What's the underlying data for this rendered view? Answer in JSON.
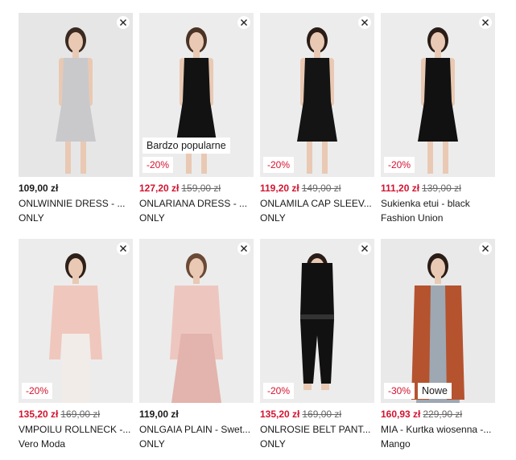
{
  "products": [
    {
      "price": "109,00 zł",
      "old_price": "",
      "name": "ONLWINNIE DRESS - ...",
      "brand": "ONLY",
      "discount": "",
      "label": "",
      "bg": "#e6e6e6",
      "garment_color": "#c9c9cc",
      "hair_color": "#3a2a22",
      "dress_style": "light"
    },
    {
      "price": "127,20 zł",
      "old_price": "159,00 zł",
      "name": "ONLARIANA DRESS - ...",
      "brand": "ONLY",
      "discount": "-20%",
      "label": "Bardzo popularne",
      "bg": "#ececec",
      "garment_color": "#121212",
      "hair_color": "#4a3325",
      "dress_style": "black"
    },
    {
      "price": "119,20 zł",
      "old_price": "149,00 zł",
      "name": "ONLAMILA CAP SLEEV...",
      "brand": "ONLY",
      "discount": "-20%",
      "label": "",
      "bg": "#ececec",
      "garment_color": "#141414",
      "hair_color": "#2a1c16",
      "dress_style": "black"
    },
    {
      "price": "111,20 zł",
      "old_price": "139,00 zł",
      "name": "Sukienka etui - black",
      "brand": "Fashion Union",
      "discount": "-20%",
      "label": "",
      "bg": "#ececec",
      "garment_color": "#111111",
      "hair_color": "#2a1c16",
      "dress_style": "black"
    },
    {
      "price": "135,20 zł",
      "old_price": "169,00 zł",
      "name": "VMPOILU ROLLNECK -...",
      "brand": "Vero Moda",
      "discount": "-20%",
      "label": "",
      "bg": "#ececec",
      "garment_color": "#f0c7bd",
      "hair_color": "#2e2019",
      "dress_style": "sweater"
    },
    {
      "price": "119,00 zł",
      "old_price": "",
      "name": "ONLGAIA PLAIN - Swet...",
      "brand": "ONLY",
      "discount": "",
      "label": "",
      "bg": "#ececec",
      "garment_color": "#eec6c0",
      "hair_color": "#6a4a36",
      "dress_style": "sweater-skirt"
    },
    {
      "price": "135,20 zł",
      "old_price": "169,00 zł",
      "name": "ONLROSIE BELT PANT...",
      "brand": "ONLY",
      "discount": "-20%",
      "label": "",
      "bg": "#ececec",
      "garment_color": "#111111",
      "hair_color": "#2a1c16",
      "dress_style": "pants"
    },
    {
      "price": "160,93 zł",
      "old_price": "229,90 zł",
      "name": "MIA - Kurtka wiosenna -...",
      "brand": "Mango",
      "discount": "-30%",
      "label": "Nowe",
      "bg": "#e9e9e9",
      "garment_color": "#b5532f",
      "hair_color": "#2a1c16",
      "dress_style": "coat"
    }
  ],
  "colors": {
    "sale": "#d3132f",
    "text": "#1a1a1a",
    "old_price": "#666666"
  },
  "icons": {
    "remove": "close-icon"
  }
}
